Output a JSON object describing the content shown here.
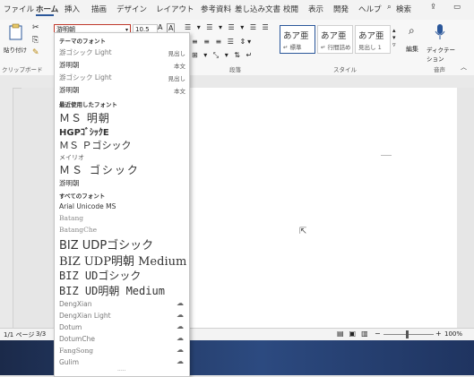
{
  "tabs": [
    "ファイル",
    "ホーム",
    "挿入",
    "描画",
    "デザイン",
    "レイアウト",
    "参考資料",
    "差し込み文書",
    "校閲",
    "表示",
    "開発",
    "ヘルプ",
    "検索"
  ],
  "active_tab": "ホーム",
  "clipboard": {
    "paste_label": "貼り付け",
    "group_label": "クリップボード"
  },
  "font_box": {
    "value": "游明朝",
    "size": "10.5"
  },
  "paragraph": {
    "group_label": "段落"
  },
  "styles": {
    "group_label": "スタイル",
    "items": [
      {
        "big": "あア亜",
        "small": "↵ 標準"
      },
      {
        "big": "あア亜",
        "small": "↵ 行間詰め"
      },
      {
        "big": "あア亜",
        "small": "見出し 1"
      }
    ]
  },
  "editing": {
    "label": "編集"
  },
  "voice": {
    "label": "ディクテーション",
    "group_label": "音声"
  },
  "status": {
    "page": "1/1 ページ",
    "words": "3/3"
  },
  "zoom": "100%",
  "font_dropdown": {
    "theme_header": "テーマのフォント",
    "theme_fonts": [
      {
        "name": "游ゴシック Light",
        "tag": "見出し"
      },
      {
        "name": "游明朝",
        "tag": "本文"
      },
      {
        "name": "游ゴシック Light",
        "tag": "見出し"
      },
      {
        "name": "游明朝",
        "tag": "本文"
      }
    ],
    "recent_header": "最近使用したフォント",
    "recent_fonts": [
      "ＭＳ 明朝",
      "HGPｺﾞｼｯｸE",
      "ＭＳ Ｐゴシック",
      "メイリオ",
      "ＭＳ ゴシック",
      "游明朝"
    ],
    "all_header": "すべてのフォント",
    "all_fonts": [
      {
        "name": "Arial Unicode MS",
        "cloud": false
      },
      {
        "name": "Batang",
        "cloud": false
      },
      {
        "name": "BatangChe",
        "cloud": false
      },
      {
        "name": "BIZ UDPゴシック",
        "cloud": false
      },
      {
        "name": "BIZ UDP明朝 Medium",
        "cloud": false
      },
      {
        "name": "BIZ UDゴシック",
        "cloud": false
      },
      {
        "name": "BIZ UD明朝 Medium",
        "cloud": false
      },
      {
        "name": "DengXian",
        "cloud": true
      },
      {
        "name": "DengXian Light",
        "cloud": true
      },
      {
        "name": "Dotum",
        "cloud": true
      },
      {
        "name": "DotumChe",
        "cloud": true
      },
      {
        "name": "FangSong",
        "cloud": true
      },
      {
        "name": "Gulim",
        "cloud": true
      }
    ]
  },
  "colors": {
    "accent": "#2b579a",
    "input_border": "#c0392b"
  }
}
